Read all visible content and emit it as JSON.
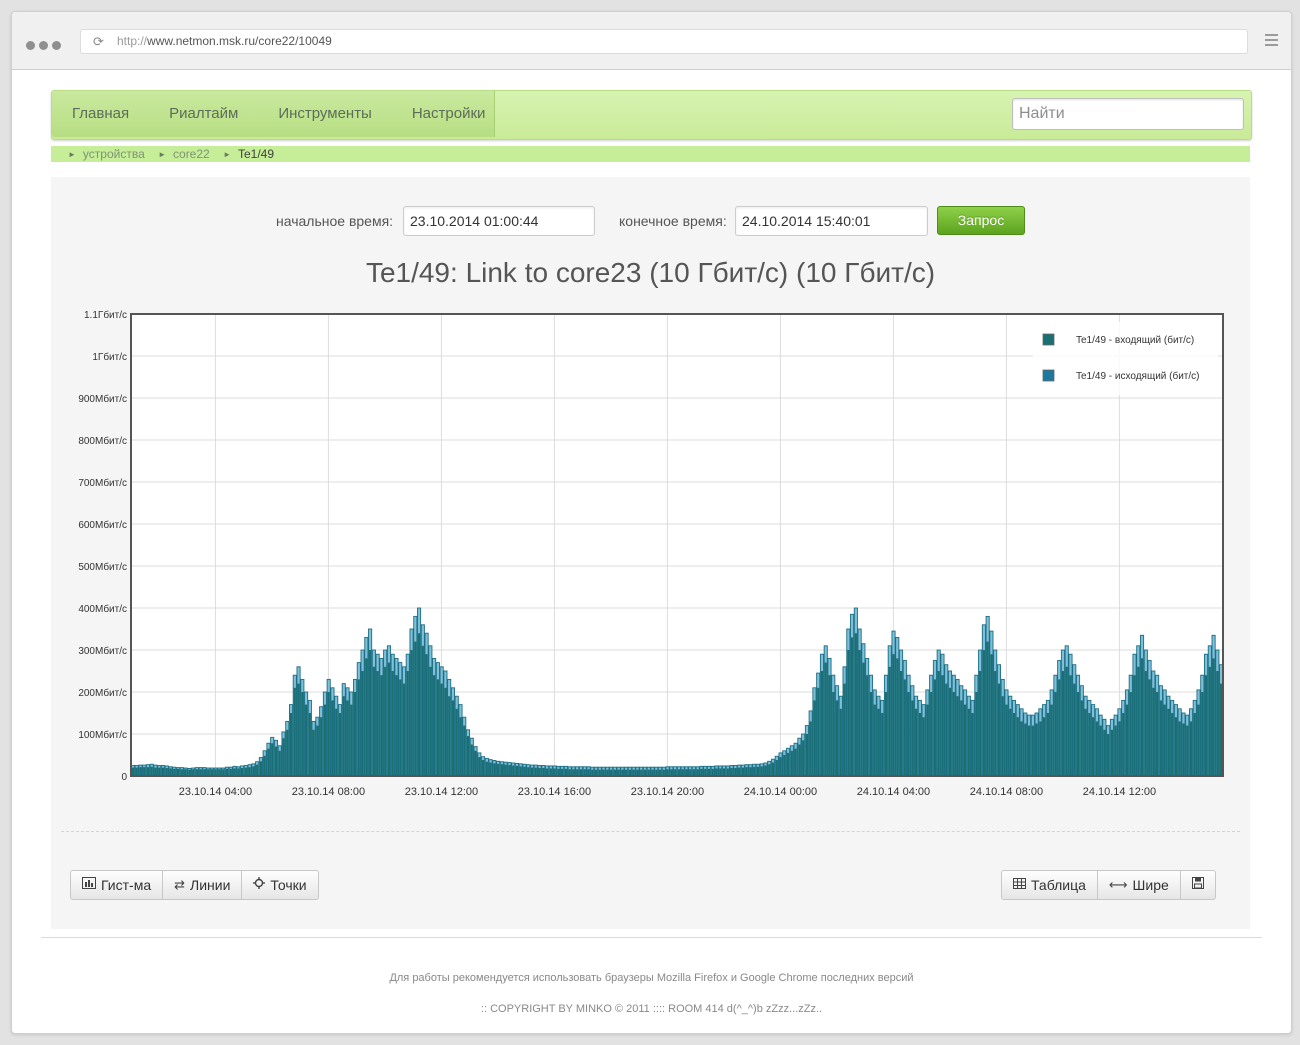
{
  "browser": {
    "url_protocol": "http://",
    "url_rest": "www.netmon.msk.ru/core22/10049"
  },
  "nav": {
    "items": [
      "Главная",
      "Риалтайм",
      "Инструменты",
      "Настройки"
    ],
    "search_placeholder": "Найти"
  },
  "breadcrumb": {
    "items": [
      "устройства",
      "core22"
    ],
    "current": "Te1/49"
  },
  "query": {
    "start_label": "начальное время:",
    "start_value": "23.10.2014 01:00:44",
    "end_label": "конечное время:",
    "end_value": "24.10.2014 15:40:01",
    "button_label": "Запрос"
  },
  "chart_title": "Te1/49: Link to core23 (10 Гбит/с) (10 Гбит/с)",
  "chart_data": {
    "type": "bar",
    "title": "Te1/49: Link to core23 (10 Гбит/с) (10 Гбит/с)",
    "xlabel": "",
    "ylabel": "",
    "x_start": "23.10.2014 01:00:44",
    "x_end": "24.10.2014 15:40:01",
    "x_tick_labels": [
      "23.10.14 04:00",
      "23.10.14 08:00",
      "23.10.14 12:00",
      "23.10.14 16:00",
      "23.10.14 20:00",
      "24.10.14 00:00",
      "24.10.14 04:00",
      "24.10.14 08:00",
      "24.10.14 12:00"
    ],
    "y_tick_labels": [
      "0",
      "100Мбит/с",
      "200Мбит/с",
      "300Мбит/с",
      "400Мбит/с",
      "500Мбит/с",
      "600Мбит/с",
      "700Мбит/с",
      "800Мбит/с",
      "900Мбит/с",
      "1Гбит/с",
      "1.1Гбит/с"
    ],
    "ylim": [
      0,
      1100
    ],
    "y_unit": "Мбит/с",
    "grid": true,
    "legend_position": "top-right",
    "colors": {
      "series_in_fill": "#1a6f72",
      "series_out_fill": "#7fbfd8",
      "series_out_stroke": "#1c6e84",
      "axis": "#555555",
      "grid": "#dddddd"
    },
    "series": [
      {
        "name": "Te1/49 - входящий (бит/с)",
        "values": [
          20,
          20,
          21,
          21,
          21,
          22,
          20,
          20,
          20,
          19,
          18,
          17,
          17,
          16,
          16,
          15,
          16,
          16,
          16,
          16,
          16,
          16,
          16,
          16,
          16,
          17,
          17,
          18,
          18,
          19,
          20,
          21,
          23,
          27,
          35,
          48,
          65,
          78,
          70,
          60,
          90,
          110,
          150,
          210,
          220,
          200,
          170,
          150,
          110,
          120,
          140,
          170,
          200,
          180,
          160,
          150,
          190,
          180,
          170,
          200,
          230,
          250,
          280,
          300,
          260,
          250,
          240,
          260,
          270,
          250,
          240,
          230,
          220,
          250,
          300,
          320,
          340,
          310,
          290,
          260,
          240,
          230,
          220,
          210,
          190,
          180,
          160,
          140,
          120,
          95,
          75,
          60,
          45,
          38,
          34,
          32,
          30,
          29,
          28,
          27,
          26,
          25,
          24,
          23,
          22,
          21,
          20,
          20,
          19,
          19,
          18,
          18,
          18,
          17,
          17,
          17,
          16,
          16,
          16,
          16,
          16,
          16,
          15,
          15,
          15,
          15,
          15,
          15,
          15,
          15,
          15,
          15,
          15,
          15,
          15,
          15,
          15,
          15,
          15,
          15,
          15,
          15,
          16,
          16,
          16,
          16,
          16,
          16,
          16,
          16,
          16,
          17,
          17,
          17,
          17,
          18,
          18,
          18,
          18,
          19,
          19,
          20,
          20,
          21,
          21,
          22,
          22,
          23,
          25,
          28,
          32,
          38,
          45,
          50,
          55,
          60,
          65,
          75,
          85,
          100,
          130,
          180,
          210,
          250,
          270,
          240,
          200,
          180,
          160,
          220,
          300,
          330,
          340,
          300,
          270,
          240,
          200,
          170,
          160,
          150,
          200,
          260,
          290,
          280,
          250,
          230,
          200,
          180,
          160,
          150,
          140,
          170,
          200,
          230,
          250,
          240,
          220,
          210,
          200,
          190,
          180,
          170,
          160,
          150,
          200,
          250,
          300,
          320,
          290,
          250,
          220,
          190,
          170,
          160,
          150,
          140,
          130,
          125,
          120,
          120,
          125,
          130,
          140,
          150,
          170,
          200,
          230,
          250,
          260,
          240,
          220,
          200,
          180,
          160,
          150,
          140,
          130,
          120,
          110,
          100,
          110,
          120,
          130,
          150,
          170,
          200,
          240,
          260,
          280,
          250,
          230,
          210,
          200,
          180,
          170,
          160,
          150,
          140,
          130,
          125,
          120,
          130,
          150,
          170,
          200,
          240,
          260,
          280,
          250,
          220
        ]
      },
      {
        "name": "Te1/49 - исходящий (бит/с)",
        "values": [
          25,
          25,
          26,
          26,
          27,
          28,
          26,
          25,
          25,
          24,
          22,
          21,
          20,
          20,
          19,
          18,
          19,
          20,
          20,
          20,
          19,
          19,
          19,
          19,
          19,
          21,
          21,
          23,
          22,
          24,
          25,
          27,
          29,
          34,
          44,
          60,
          78,
          92,
          85,
          72,
          105,
          130,
          170,
          240,
          260,
          230,
          200,
          180,
          130,
          140,
          165,
          200,
          230,
          210,
          190,
          170,
          220,
          210,
          200,
          230,
          270,
          300,
          330,
          350,
          300,
          290,
          280,
          300,
          310,
          290,
          280,
          270,
          260,
          290,
          350,
          380,
          400,
          360,
          340,
          310,
          280,
          270,
          260,
          250,
          230,
          210,
          190,
          170,
          140,
          110,
          90,
          70,
          55,
          46,
          42,
          39,
          37,
          35,
          34,
          33,
          32,
          31,
          30,
          29,
          28,
          27,
          26,
          26,
          25,
          25,
          24,
          24,
          24,
          23,
          23,
          23,
          22,
          22,
          22,
          22,
          22,
          22,
          21,
          21,
          21,
          21,
          21,
          21,
          21,
          21,
          21,
          21,
          21,
          21,
          21,
          21,
          21,
          21,
          21,
          21,
          21,
          21,
          22,
          22,
          22,
          22,
          22,
          22,
          22,
          22,
          22,
          23,
          23,
          23,
          23,
          24,
          24,
          24,
          24,
          25,
          25,
          26,
          26,
          27,
          27,
          28,
          28,
          29,
          31,
          35,
          40,
          47,
          55,
          60,
          66,
          72,
          78,
          90,
          100,
          120,
          155,
          210,
          245,
          290,
          310,
          280,
          240,
          215,
          190,
          260,
          350,
          385,
          400,
          350,
          315,
          280,
          240,
          205,
          190,
          180,
          240,
          310,
          345,
          330,
          300,
          275,
          240,
          215,
          190,
          180,
          170,
          205,
          240,
          275,
          300,
          290,
          265,
          250,
          240,
          230,
          215,
          205,
          190,
          180,
          240,
          300,
          360,
          380,
          345,
          300,
          265,
          230,
          205,
          190,
          180,
          170,
          160,
          150,
          145,
          145,
          150,
          160,
          170,
          180,
          205,
          240,
          275,
          300,
          310,
          290,
          265,
          240,
          215,
          190,
          180,
          170,
          160,
          145,
          135,
          120,
          135,
          145,
          160,
          180,
          205,
          240,
          290,
          310,
          335,
          300,
          275,
          250,
          240,
          215,
          205,
          190,
          180,
          170,
          160,
          150,
          145,
          160,
          180,
          205,
          240,
          290,
          310,
          335,
          300,
          265
        ]
      }
    ]
  },
  "toolbar_left": [
    {
      "icon": "bar-chart-icon",
      "label": "Гист-ма"
    },
    {
      "icon": "swap-arrows-icon",
      "label": "Линии"
    },
    {
      "icon": "crosshair-icon",
      "label": "Точки"
    }
  ],
  "toolbar_right": [
    {
      "icon": "table-icon",
      "label": "Таблица"
    },
    {
      "icon": "horizontal-arrows-icon",
      "label": "Шире"
    },
    {
      "icon": "save-icon",
      "label": ""
    }
  ],
  "footer": {
    "line1": "Для работы рекомендуется использовать браузеры Mozilla Firefox и Google Chrome последних версий",
    "line2": ":: COPYRIGHT BY MINKO © 2011 :::: ROOM 414 d(^_^)b zZzz...zZz.."
  }
}
